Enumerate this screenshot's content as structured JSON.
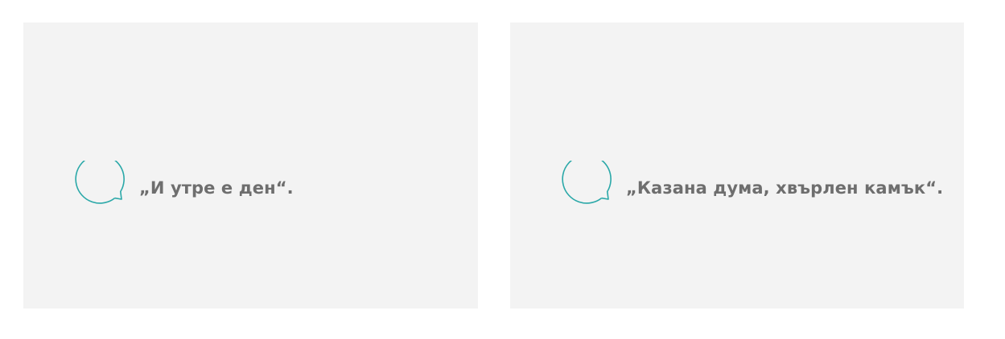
{
  "cards": [
    {
      "icon": "speech-bubble-icon",
      "quote": "„И утре е ден“."
    },
    {
      "icon": "speech-bubble-icon",
      "quote": "„Казана дума, хвърлен камък“."
    }
  ],
  "colors": {
    "card_background": "#f3f3f3",
    "icon_stroke": "#2aa8a8",
    "quote_text": "#6e6e6e"
  }
}
